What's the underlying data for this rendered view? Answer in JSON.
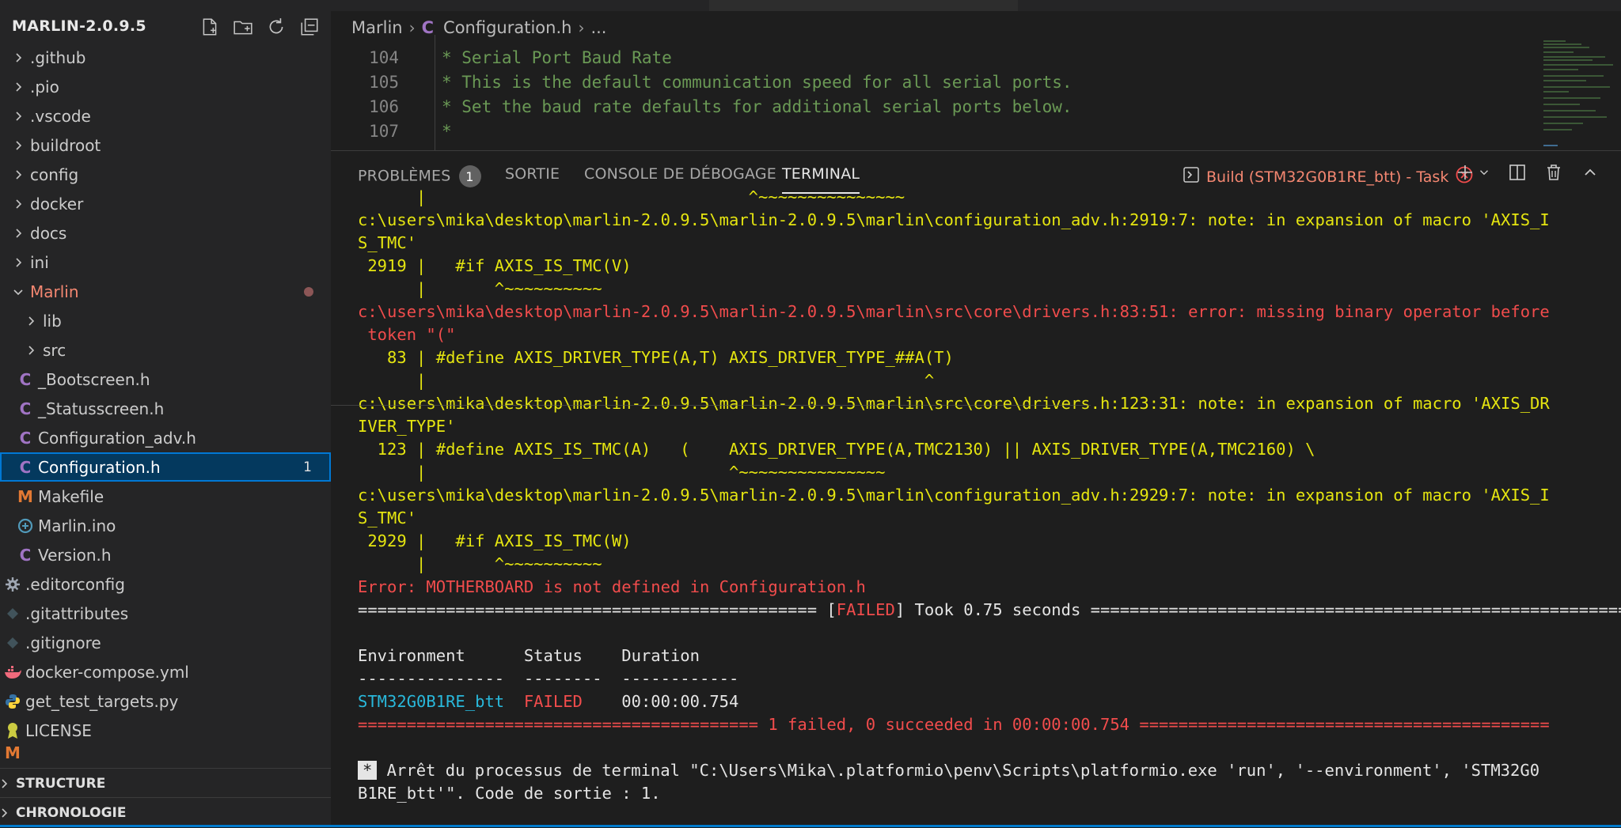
{
  "explorer": {
    "root": "MARLIN-2.0.9.5",
    "actions": [
      "new-file-icon",
      "new-folder-icon",
      "refresh-icon",
      "collapse-all-icon"
    ],
    "items": [
      {
        "label": ".github",
        "type": "folder"
      },
      {
        "label": ".pio",
        "type": "folder"
      },
      {
        "label": ".vscode",
        "type": "folder"
      },
      {
        "label": "buildroot",
        "type": "folder"
      },
      {
        "label": "config",
        "type": "folder"
      },
      {
        "label": "docker",
        "type": "folder"
      },
      {
        "label": "docs",
        "type": "folder"
      },
      {
        "label": "ini",
        "type": "folder"
      },
      {
        "label": "Marlin",
        "type": "folder-open"
      },
      {
        "label": "lib",
        "type": "folder"
      },
      {
        "label": "src",
        "type": "folder"
      },
      {
        "label": "_Bootscreen.h",
        "type": "c"
      },
      {
        "label": "_Statusscreen.h",
        "type": "c"
      },
      {
        "label": "Configuration_adv.h",
        "type": "c"
      },
      {
        "label": "Configuration.h",
        "type": "c",
        "badge": "1"
      },
      {
        "label": "Makefile",
        "type": "m"
      },
      {
        "label": "Marlin.ino",
        "type": "ino"
      },
      {
        "label": "Version.h",
        "type": "c"
      },
      {
        "label": ".editorconfig",
        "type": "gear"
      },
      {
        "label": ".gitattributes",
        "type": "git"
      },
      {
        "label": ".gitignore",
        "type": "git"
      },
      {
        "label": "docker-compose.yml",
        "type": "docker"
      },
      {
        "label": "get_test_targets.py",
        "type": "py"
      },
      {
        "label": "LICENSE",
        "type": "license"
      }
    ],
    "sections": [
      "STRUCTURE",
      "CHRONOLOGIE"
    ]
  },
  "breadcrumb": {
    "root": "Marlin",
    "file": "Configuration.h",
    "more": "..."
  },
  "code": {
    "lines": [
      {
        "n": "104",
        "text": "* Serial Port Baud Rate"
      },
      {
        "n": "105",
        "text": "* This is the default communication speed for all serial ports."
      },
      {
        "n": "106",
        "text": "* Set the baud rate defaults for additional serial ports below."
      },
      {
        "n": "107",
        "text": "*"
      }
    ]
  },
  "panel": {
    "tabs": {
      "problems": "PROBLÈMES",
      "problems_count": "1",
      "output": "SORTIE",
      "debug": "CONSOLE DE DÉBOGAGE",
      "terminal": "TERMINAL"
    },
    "task": "Build (STM32G0B1RE_btt) - Task"
  },
  "terminal": {
    "lines": [
      "      |                                 ^~~~~~~~~~~~~~~~",
      "c:\\users\\mika\\desktop\\marlin-2.0.9.5\\marlin-2.0.9.5\\marlin\\configuration_adv.h:2919:7: note: in expansion of macro 'AXIS_I",
      "S_TMC'",
      " 2919 |   #if AXIS_IS_TMC(V)",
      "      |       ^~~~~~~~~~~",
      "c:\\users\\mika\\desktop\\marlin-2.0.9.5\\marlin-2.0.9.5\\marlin\\src\\core\\drivers.h:83:51: error: missing binary operator before",
      " token \"(\"",
      "   83 | #define AXIS_DRIVER_TYPE(A,T) AXIS_DRIVER_TYPE_##A(T)",
      "      |                                                   ^",
      "c:\\users\\mika\\desktop\\marlin-2.0.9.5\\marlin-2.0.9.5\\marlin\\src\\core\\drivers.h:123:31: note: in expansion of macro 'AXIS_DR",
      "IVER_TYPE'",
      "  123 | #define AXIS_IS_TMC(A)   (    AXIS_DRIVER_TYPE(A,TMC2130) || AXIS_DRIVER_TYPE(A,TMC2160) \\",
      "      |                               ^~~~~~~~~~~~~~~~",
      "c:\\users\\mika\\desktop\\marlin-2.0.9.5\\marlin-2.0.9.5\\marlin\\configuration_adv.h:2929:7: note: in expansion of macro 'AXIS_I",
      "S_TMC'",
      " 2929 |   #if AXIS_IS_TMC(W)",
      "      |       ^~~~~~~~~~~",
      "Error: MOTHERBOARD is not defined in Configuration.h"
    ],
    "failed_sep_left": "=============================================== [",
    "failed_word": "FAILED",
    "failed_sep_right": "] Took 0.75 seconds ===========================================================",
    "table_header": "Environment      Status    Duration",
    "table_rule": "---------------  --------  ------------",
    "env": "STM32G0B1RE_btt",
    "status": "FAILED",
    "duration": "00:00:00.754",
    "summary": "========================================= 1 failed, 0 succeeded in 00:00:00.754 ==========================================",
    "star": "*",
    "exit_line1": " Arrêt du processus de terminal \"C:\\Users\\Mika\\.platformio\\penv\\Scripts\\platformio.exe 'run', '--environment', 'STM32G0",
    "exit_line2": "B1RE_btt'\". Code de sortie : 1."
  }
}
